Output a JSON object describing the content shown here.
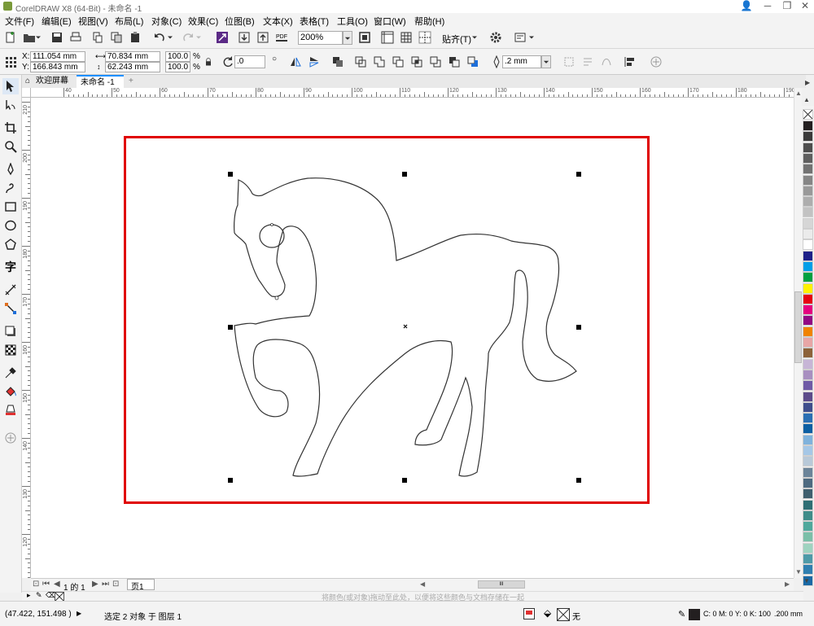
{
  "app": {
    "title": "CorelDRAW X8 (64-Bit) - 未命名 -1"
  },
  "menu": [
    "文件(F)",
    "编辑(E)",
    "视图(V)",
    "布局(L)",
    "对象(C)",
    "效果(C)",
    "位图(B)",
    "文本(X)",
    "表格(T)",
    "工具(O)",
    "窗口(W)",
    "帮助(H)"
  ],
  "toolbar": {
    "zoom": "200%",
    "snap_label": "贴齐(T)",
    "pdf_label": "PDF"
  },
  "properties": {
    "x_label": "X:",
    "x_value": "111.054 mm",
    "y_label": "Y:",
    "y_value": "166.843 mm",
    "width": "70.834 mm",
    "height": "62.243 mm",
    "scale_w": "100.0",
    "scale_h": "100.0",
    "percent": "%",
    "rotation": ".0",
    "outline_width": ".2 mm"
  },
  "tabs": {
    "welcome": "欢迎屏幕",
    "document": "未命名 -1",
    "add": "+"
  },
  "hruler_labels": [
    "40",
    "50",
    "60",
    "70",
    "80",
    "90",
    "100",
    "110",
    "120",
    "130",
    "140",
    "150",
    "160",
    "170",
    "180",
    "190"
  ],
  "vruler_labels": [
    "210",
    "200",
    "190",
    "180",
    "170",
    "160",
    "150",
    "140",
    "130",
    "120",
    "110"
  ],
  "pagenav": {
    "page_count": "1 的 1",
    "page_tab": "页1"
  },
  "docpalette": {
    "hint": "将颜色(或对象)拖动至此处，以便将这些颜色与文档存储在一起"
  },
  "status": {
    "coords": "(47.422, 151.498 )",
    "selection": "选定 2 对象 于 图层 1",
    "fill": "无",
    "outline_color": "C: 0 M: 0 Y: 0 K: 100",
    "outline_width": ".200 mm"
  },
  "colors": {
    "accent": "#1e90ff",
    "frame": "#e00000",
    "palette": [
      "#231f20",
      "#3a3a3a",
      "#4d4d4d",
      "#5f5f5f",
      "#727272",
      "#858585",
      "#999999",
      "#adadad",
      "#c2c2c2",
      "#d6d6d6",
      "#ebebeb",
      "#ffffff",
      "#1d2088",
      "#009fe8",
      "#00a040",
      "#fff100",
      "#e60012",
      "#e4007f",
      "#920783",
      "#f08300",
      "#e7a6a6",
      "#8c6239",
      "#c7b5d6",
      "#a88fc0",
      "#6f5aa6",
      "#5c4b8a",
      "#3f4e8c",
      "#2a6fb3",
      "#0b5fa3",
      "#7fb2dc",
      "#a5c7e6",
      "#b8c9d8",
      "#6b8499",
      "#4e6a80",
      "#3f5f6e",
      "#2e6e74",
      "#3f8c89",
      "#4fa89c",
      "#7bbfa8",
      "#9fd3c0",
      "#4e9aa8",
      "#2f7fb0",
      "#1969a5"
    ]
  }
}
